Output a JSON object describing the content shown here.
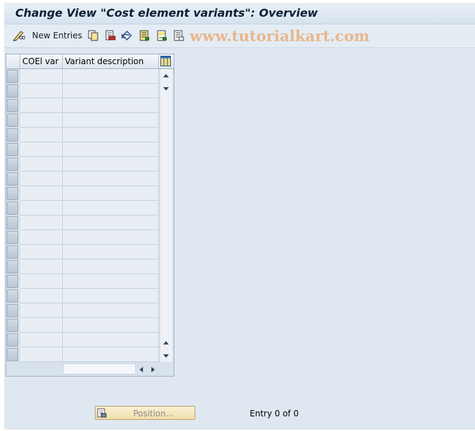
{
  "header": {
    "title": "Change View \"Cost element variants\": Overview"
  },
  "toolbar": {
    "new_entries_label": "New Entries",
    "icons": [
      "change-display-icon",
      "copy-icon",
      "delete-icon",
      "undo-icon",
      "select-all-icon",
      "select-block-icon",
      "deselect-all-icon"
    ]
  },
  "watermark": {
    "text": "www.tutorialkart.com"
  },
  "table": {
    "columns": [
      "COEl var",
      "Variant description"
    ],
    "row_count": 20,
    "rows": []
  },
  "footer": {
    "position_label": "Position...",
    "entry_text": "Entry 0 of 0"
  },
  "colors": {
    "background": "#dfe8f1",
    "title_text": "#0d1f33",
    "watermark": "#e8b78a",
    "position_button": "#f0deaa"
  }
}
